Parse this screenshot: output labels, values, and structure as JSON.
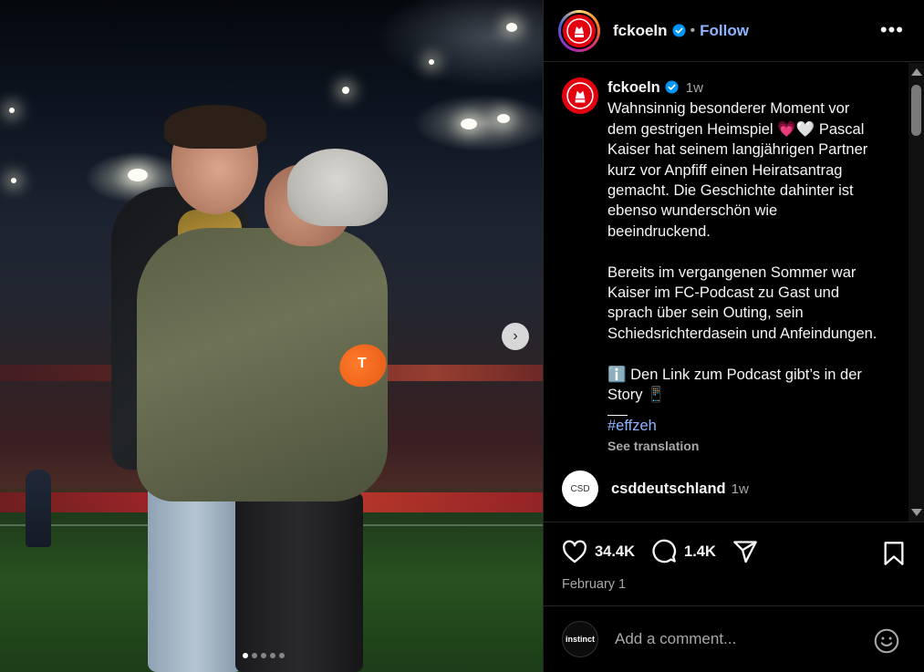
{
  "post": {
    "username": "fckoeln",
    "follow_label": "Follow",
    "separator": "•",
    "more_label": "•••",
    "time_ago": "1w",
    "caption": "Wahnsinnig besonderer Moment vor dem gestrigen Heimspiel 💗🤍 Pascal Kaiser hat seinem langjährigen Partner kurz vor Anpfiff einen Heiratsantrag gemacht. Die Geschichte dahinter ist ebenso wunderschön wie beeindruckend.\n\nBereits im vergangenen Sommer war Kaiser im FC-Podcast zu Gast und sprach über sein Outing, sein Schiedsrichterdasein und Anfeindungen.\n\nℹ️ Den Link zum Podcast gibt’s in der Story 📱",
    "hashtag": "#effzeh",
    "see_translation": "See translation",
    "likes": "34.4K",
    "comments_count": "1.4K",
    "date": "February 1"
  },
  "next_comment": {
    "avatar_text": "CSD",
    "username": "csddeutschland",
    "time_ago": "1w"
  },
  "add_comment": {
    "avatar_text": "instinct",
    "placeholder": "Add a comment..."
  },
  "carousel": {
    "total": 5,
    "active_index": 0,
    "next_label": "›"
  },
  "colors": {
    "link": "#8fb4ff",
    "brand_red": "#e3000f",
    "muted": "#a8a8a8",
    "verified": "#0095f6"
  },
  "icons": [
    "heart-icon",
    "comment-icon",
    "share-icon",
    "bookmark-icon",
    "emoji-icon",
    "verified-icon",
    "chevron-right-icon",
    "more-icon"
  ]
}
